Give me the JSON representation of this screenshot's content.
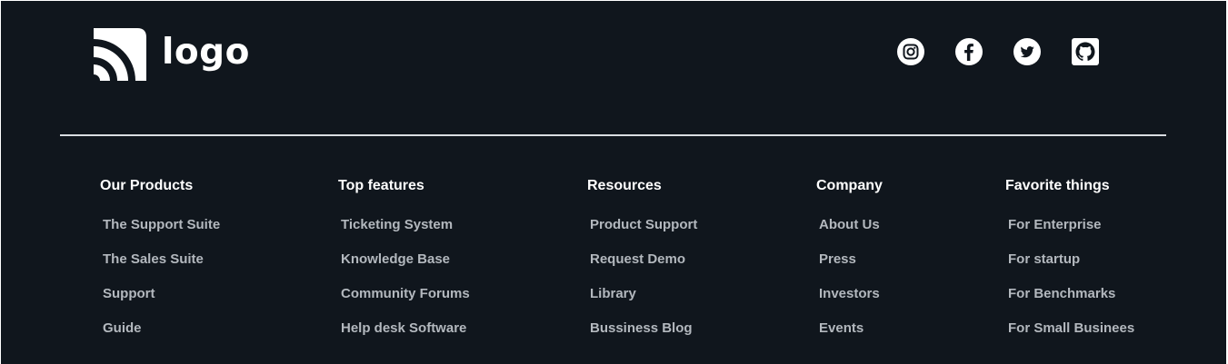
{
  "brand": {
    "logo_text": "logo"
  },
  "social": {
    "items": [
      {
        "icon": "instagram-icon"
      },
      {
        "icon": "facebook-icon"
      },
      {
        "icon": "twitter-icon"
      },
      {
        "icon": "github-icon"
      }
    ]
  },
  "columns": [
    {
      "title": "Our Products",
      "links": [
        "The Support Suite",
        "The Sales Suite",
        "Support",
        "Guide"
      ]
    },
    {
      "title": "Top features",
      "links": [
        "Ticketing System",
        "Knowledge Base",
        "Community Forums",
        "Help desk Software"
      ]
    },
    {
      "title": "Resources",
      "links": [
        "Product Support",
        "Request Demo",
        "Library",
        "Bussiness Blog"
      ]
    },
    {
      "title": "Company",
      "links": [
        "About Us",
        "Press",
        "Investors",
        "Events"
      ]
    },
    {
      "title": "Favorite things",
      "links": [
        "For Enterprise",
        "For startup",
        "For Benchmarks",
        "For Small Businees"
      ]
    }
  ],
  "colors": {
    "background": "#10161d",
    "heading": "#ffffff",
    "link": "#b3b8be",
    "divider": "#d9dde2"
  }
}
